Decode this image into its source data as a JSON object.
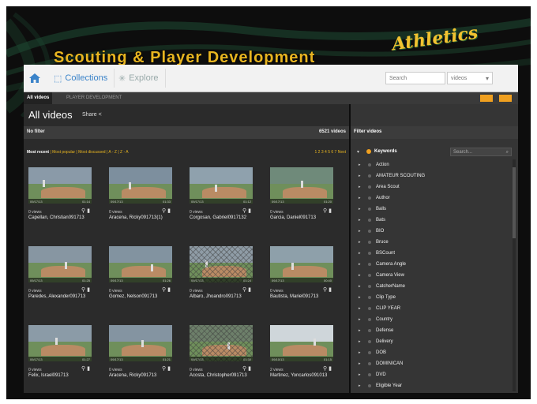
{
  "header": {
    "title": "Scouting & Player Development",
    "logo_text": "Athletics"
  },
  "nav": {
    "home_icon": "home-icon",
    "collections_label": "Collections",
    "explore_label": "Explore",
    "search_placeholder": "Search",
    "select_value": "videos",
    "accent": "#3a83c9"
  },
  "tabs": [
    {
      "label": "All videos"
    },
    {
      "label": "PLAYER DEVELOPMENT"
    }
  ],
  "main": {
    "title": "All videos",
    "share_label": "Share <",
    "no_filter": "No filter",
    "video_count": "6521 videos",
    "sort_options": [
      "Most recent",
      "Most popular",
      "Most discussed",
      "A - Z",
      "Z - A"
    ],
    "pages": "1 2 3 4 5 6 7 Next"
  },
  "videos": [
    {
      "views": "0 views",
      "name": "Capellan, Christian091713"
    },
    {
      "views": "0 views",
      "name": "Aracena, Ricky091713(1)"
    },
    {
      "views": "0 views",
      "name": "Corgosan, Gabriel0917132"
    },
    {
      "views": "0 views",
      "name": "Garcia, Daniel091713"
    },
    {
      "views": "0 views",
      "name": "Paredes, Alexander091713"
    },
    {
      "views": "0 views",
      "name": "Gomez, Nelson091713"
    },
    {
      "views": "0 views",
      "name": "Albaro, Jhoandro091713"
    },
    {
      "views": "0 views",
      "name": "Bautista, Mariel091713"
    },
    {
      "views": "0 views",
      "name": "Felix, Israel091713"
    },
    {
      "views": "0 views",
      "name": "Aracena, Ricky091713"
    },
    {
      "views": "0 views",
      "name": "Acosta, Christopher091713"
    },
    {
      "views": "2 views",
      "name": "Martinez, Yoncarlos091013"
    }
  ],
  "thumbnail_labels": [
    {
      "date": "09/17/13",
      "time": "01:14"
    },
    {
      "date": "09/17/13",
      "time": "01:33"
    },
    {
      "date": "09/17/13",
      "time": "01:12"
    },
    {
      "date": "09/17/13",
      "time": "01:20"
    },
    {
      "date": "09/17/13",
      "time": "01:25"
    },
    {
      "date": "09/17/13",
      "time": "01:26"
    },
    {
      "date": "09/17/13",
      "time": "01:24"
    },
    {
      "date": "09/17/13",
      "time": "00:40"
    },
    {
      "date": "09/17/13",
      "time": "01:27"
    },
    {
      "date": "09/17/13",
      "time": "01:21"
    },
    {
      "date": "09/17/13",
      "time": "01:30"
    },
    {
      "date": "09/10/13",
      "time": "01:15"
    }
  ],
  "filter_panel": {
    "title": "Filter videos",
    "keywords_label": "Keywords",
    "search_placeholder": "Search...",
    "items": [
      "Action",
      "AMATEUR SCOUTING",
      "Area Scout",
      "Author",
      "Balls",
      "Bats",
      "BIO",
      "Bruce",
      "BSCount",
      "Camera Angle",
      "Camera View",
      "CatcherName",
      "Clip Type",
      "CLIP YEAR",
      "Country",
      "Defense",
      "Delivery",
      "DOB",
      "DOMINICAN",
      "DVD",
      "Eligible Year"
    ]
  },
  "colors": {
    "gold": "#e8b520",
    "orange": "#f0a020",
    "dark": "#2b2b2b"
  }
}
